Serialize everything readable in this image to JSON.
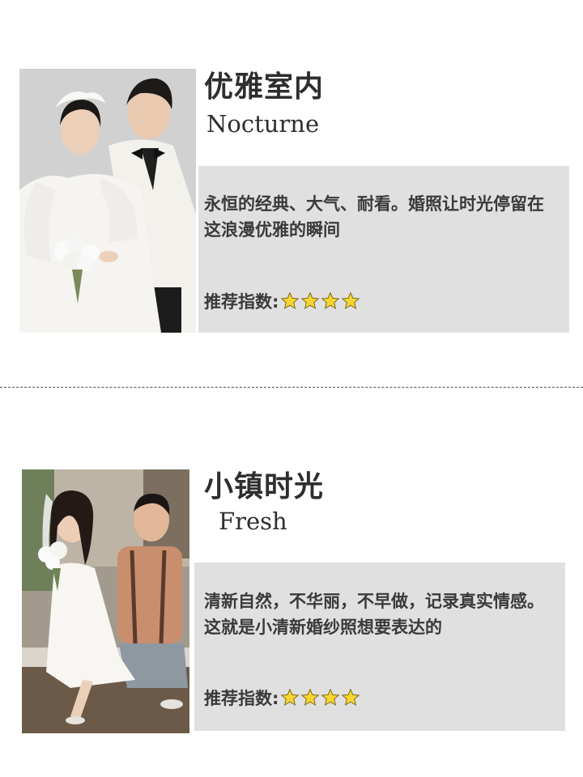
{
  "cards": [
    {
      "title_zh": "优雅室内",
      "title_en": "Nocturne",
      "description": "永恒的经典、大气、耐看。婚照让时光停留在这浪漫优雅的瞬间",
      "rating_label": "推荐指数:",
      "rating": 4,
      "rating_max": 4,
      "photo": "wedding-photo-indoor"
    },
    {
      "title_zh": "小镇时光",
      "title_en": "Fresh",
      "description": "清新自然，不华丽，不早做，记录真实情感。这就是小清新婚纱照想要表达的",
      "rating_label": "推荐指数:",
      "rating": 4,
      "rating_max": 4,
      "photo": "wedding-photo-outdoor"
    }
  ],
  "colors": {
    "panel": "#e0e0e0",
    "star_fill": "#f7d530",
    "star_stroke": "#7a6a20",
    "text": "#333333"
  }
}
